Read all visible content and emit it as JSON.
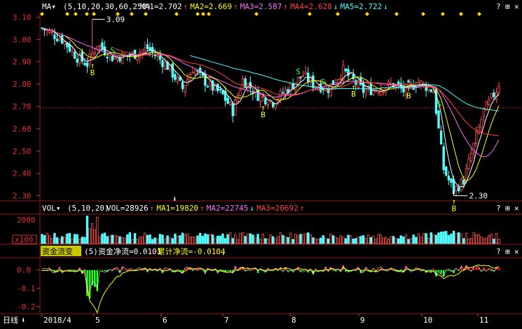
{
  "colors": {
    "bg": "#000000",
    "grid": "#8b1a1a",
    "up": "#ff5050",
    "down": "#54ffff",
    "text": "#ffffff",
    "axis": "#e03030",
    "ma1": "#ffffff",
    "ma2": "#ffff00",
    "ma3": "#ff66ff",
    "ma4": "#ff4040",
    "ma5": "#40ffff",
    "buy": "#ffff00",
    "sell": "#40ff40",
    "flow_pos": "#ff2020",
    "flow_neg": "#20ff20"
  },
  "price_panel": {
    "indicator": "MA▾",
    "params": "(5,10,20,30,60,250)",
    "legend": [
      {
        "label": "MA1=2.702",
        "arrow": "↑",
        "color": "#ffffff"
      },
      {
        "label": "MA2=2.669",
        "arrow": "↑",
        "color": "#ffff00"
      },
      {
        "label": "MA3=2.587",
        "arrow": "↑",
        "color": "#ff66ff"
      },
      {
        "label": "MA4=2.628",
        "arrow": "↓",
        "color": "#ff4040"
      },
      {
        "label": "MA5=2.722",
        "arrow": "↓",
        "color": "#40ffff"
      }
    ],
    "high_label": "3.09",
    "low_label": "2.30",
    "buttons": [
      "?",
      "⊞",
      "✕"
    ]
  },
  "volume_panel": {
    "indicator": "VOL▾",
    "params": "(5,10,20)",
    "legend": [
      {
        "label": "VOL=28926",
        "arrow": "↑",
        "color": "#ffffff"
      },
      {
        "label": "MA1=19820",
        "arrow": "↑",
        "color": "#ffff00"
      },
      {
        "label": "MA2=22745",
        "arrow": "↓",
        "color": "#ff66ff"
      },
      {
        "label": "MA3=20692",
        "arrow": "↑",
        "color": "#ff4040"
      }
    ],
    "unit": "x100",
    "tick": "2000",
    "buttons": [
      "?",
      "⊞",
      "✕"
    ]
  },
  "flow_panel": {
    "indicator": "资金流变",
    "params": "(5)",
    "legend": [
      {
        "label": "资金净流=0.0101",
        "arrow": "↑",
        "color": "#ffffff"
      },
      {
        "label": "累计净流=-0.0104",
        "arrow": "↑",
        "color": "#ffff00"
      }
    ],
    "tail": ",",
    "buttons": [
      "?",
      "⊞",
      "✕"
    ]
  },
  "bottom_bar": {
    "period": "日线",
    "arrow": "⬇",
    "dates": [
      "2018/4",
      "5",
      "6",
      "7",
      "8",
      "9",
      "10",
      "11"
    ]
  },
  "chart_data": [
    {
      "type": "candlestick",
      "title": "",
      "y_ticks": [
        3.1,
        3.0,
        2.9,
        2.8,
        2.7,
        2.6,
        2.5,
        2.4,
        2.3
      ],
      "ylim": [
        2.28,
        3.12
      ],
      "x_months": [
        "2018/4",
        "5",
        "6",
        "7",
        "8",
        "9",
        "10",
        "11"
      ],
      "last_close": 2.79,
      "high": 3.09,
      "low": 2.3,
      "signals": [
        {
          "label": "B",
          "kind": "buy"
        },
        {
          "label": "S",
          "kind": "sell"
        }
      ],
      "series": [
        {
          "name": "MA1",
          "last": 2.702
        },
        {
          "name": "MA2",
          "last": 2.669
        },
        {
          "name": "MA3",
          "last": 2.587
        },
        {
          "name": "MA4",
          "last": 2.628
        },
        {
          "name": "MA5",
          "last": 2.722
        }
      ]
    },
    {
      "type": "bar",
      "title": "",
      "y_ticks": [
        2000
      ],
      "unit": "x100",
      "last": 28926,
      "series": [
        {
          "name": "MA1",
          "last": 19820
        },
        {
          "name": "MA2",
          "last": 22745
        },
        {
          "name": "MA3",
          "last": 20692
        }
      ]
    },
    {
      "type": "bar",
      "title": "",
      "y_ticks": [
        0.0,
        -0.1,
        -0.2
      ],
      "ylim": [
        -0.23,
        0.06
      ],
      "series": [
        {
          "name": "资金净流",
          "last": 0.0101
        },
        {
          "name": "累计净流",
          "last": -0.0104
        }
      ]
    }
  ]
}
